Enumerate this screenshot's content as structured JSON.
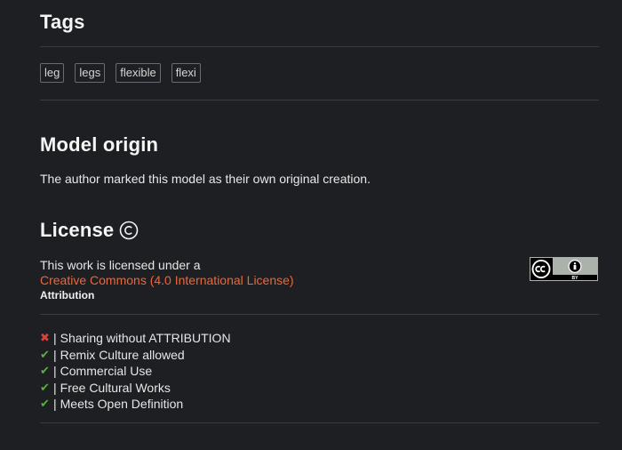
{
  "tags_section": {
    "title": "Tags",
    "tags": [
      "leg",
      "legs",
      "flexible",
      "flexi"
    ]
  },
  "origin_section": {
    "title": "Model origin",
    "text": "The author marked this model as their own original creation."
  },
  "license_section": {
    "title": "License",
    "title_icon": "copyright-icon",
    "intro": "This work is licensed under a",
    "link_text": "Creative Commons (4.0 International License)",
    "type": "Attribution",
    "badge_icon": "cc-by-badge",
    "badge_text": "BY",
    "permissions": [
      {
        "allowed": false,
        "icon": "cross-icon",
        "label": "Sharing without ATTRIBUTION"
      },
      {
        "allowed": true,
        "icon": "check-icon",
        "label": "Remix Culture allowed"
      },
      {
        "allowed": true,
        "icon": "check-icon",
        "label": "Commercial Use"
      },
      {
        "allowed": true,
        "icon": "check-icon",
        "label": "Free Cultural Works"
      },
      {
        "allowed": true,
        "icon": "check-icon",
        "label": "Meets Open Definition"
      }
    ],
    "separator": "|"
  },
  "colors": {
    "background": "#1e1f22",
    "link": "#e8683c",
    "check": "#56b33b",
    "cross": "#d9413b"
  }
}
